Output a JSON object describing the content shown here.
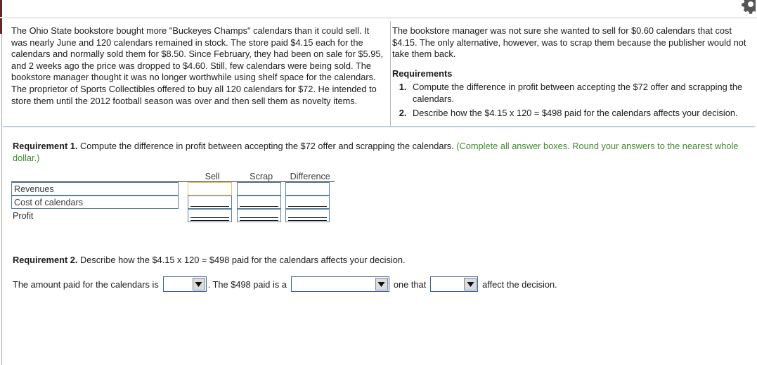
{
  "window": {
    "top_right_icon": "gear-icon"
  },
  "problem": {
    "left_paragraphs": [
      "The Ohio State bookstore bought more \"Buckeyes Champs\" calendars than it could sell. It was nearly June and 120 calendars remained in stock. The store paid $4.15 each for the calendars and normally sold them for $8.50. Since February, they had been on sale for $5.95, and 2 weeks ago the price was dropped to $4.60. Still, few calendars were being sold. The bookstore manager thought it was no longer worthwhile using shelf space for the calendars.",
      "The proprietor of Sports Collectibles offered to buy all 120 calendars for $72. He intended to store them until the 2012 football season was over and then sell them as novelty items."
    ],
    "right_paragraph": "The bookstore manager was not sure she wanted to sell for $0.60 calendars that cost $4.15. The only alternative, however, was to scrap them because the publisher would not take them back.",
    "requirements_heading": "Requirements",
    "requirements": [
      "Compute the difference in profit between accepting the $72 offer and scrapping the calendars.",
      "Describe how the $4.15 x 120 = $498 paid for the calendars affects your decision."
    ]
  },
  "requirement1": {
    "label": "Requirement 1.",
    "prompt": "Compute the difference in profit between accepting the $72 offer and scrapping the calendars.",
    "hint": "(Complete all answer boxes. Round your answers to the nearest whole dollar.)",
    "hint_color": "#3f8a2e"
  },
  "table": {
    "columns": [
      "Sell",
      "Scrap",
      "Difference"
    ],
    "rows": [
      {
        "label": "Revenues",
        "label_editable": true,
        "cells": [
          {
            "value": "",
            "rule": "none",
            "focused": true
          },
          {
            "value": "",
            "rule": "none",
            "focused": false
          },
          {
            "value": "",
            "rule": "none",
            "focused": false
          }
        ]
      },
      {
        "label": "Cost of calendars",
        "label_editable": true,
        "cells": [
          {
            "value": "",
            "rule": "single",
            "focused": false
          },
          {
            "value": "",
            "rule": "single",
            "focused": false
          },
          {
            "value": "",
            "rule": "single",
            "focused": false
          }
        ]
      },
      {
        "label": "Profit",
        "label_editable": false,
        "cells": [
          {
            "value": "",
            "rule": "double",
            "focused": false
          },
          {
            "value": "",
            "rule": "double",
            "focused": false
          },
          {
            "value": "",
            "rule": "double",
            "focused": false
          }
        ]
      }
    ]
  },
  "requirement2": {
    "label": "Requirement 2.",
    "prompt": "Describe how the $4.15 x 120 = $498 paid for the calendars affects your decision.",
    "sentence_part1": "The amount paid for the calendars is",
    "sentence_part2": ". The $498 paid is a",
    "sentence_part3": "one that",
    "sentence_part4": "affect the decision.",
    "dropdowns": [
      {
        "name": "amount-paid-dropdown",
        "value": ""
      },
      {
        "name": "cost-type-dropdown",
        "value": ""
      },
      {
        "name": "affects-dropdown",
        "value": ""
      }
    ]
  }
}
